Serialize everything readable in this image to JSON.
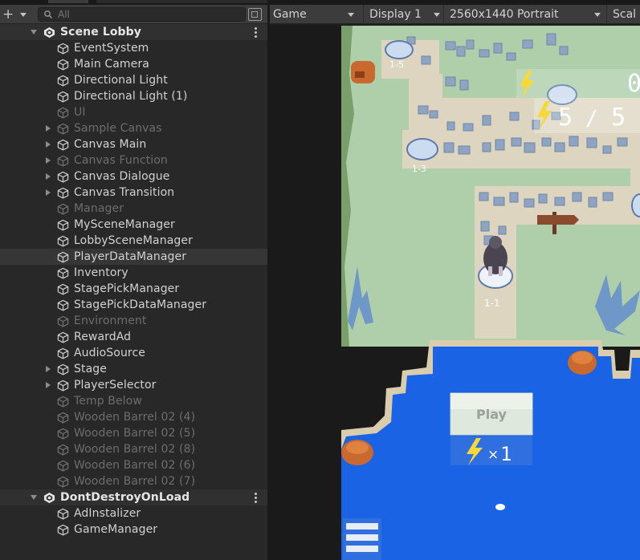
{
  "hierarchy": {
    "add_button": "+",
    "search": {
      "placeholder": "All",
      "value": ""
    },
    "items": [
      {
        "label": "Scene Lobby",
        "kind": "scene"
      },
      {
        "label": "EventSystem"
      },
      {
        "label": "Main Camera"
      },
      {
        "label": "Directional Light"
      },
      {
        "label": "Directional Light (1)"
      },
      {
        "label": "UI",
        "inactive": true
      },
      {
        "label": "Sample Canvas",
        "inactive": true,
        "collapsed": true
      },
      {
        "label": "Canvas Main",
        "collapsed": true
      },
      {
        "label": "Canvas Function",
        "inactive": true,
        "collapsed": true
      },
      {
        "label": "Canvas Dialogue",
        "collapsed": true
      },
      {
        "label": "Canvas Transition",
        "collapsed": true
      },
      {
        "label": "Manager",
        "inactive": true
      },
      {
        "label": "MySceneManager"
      },
      {
        "label": "LobbySceneManager"
      },
      {
        "label": "PlayerDataManager",
        "selected": true
      },
      {
        "label": "Inventory"
      },
      {
        "label": "StagePickManager"
      },
      {
        "label": "StagePickDataManager"
      },
      {
        "label": "Environment",
        "inactive": true
      },
      {
        "label": "RewardAd"
      },
      {
        "label": "AudioSource"
      },
      {
        "label": "Stage",
        "collapsed": true
      },
      {
        "label": "PlayerSelector",
        "collapsed": true
      },
      {
        "label": "Temp Below",
        "inactive": true
      },
      {
        "label": "Wooden Barrel 02 (4)",
        "inactive": true
      },
      {
        "label": "Wooden Barrel 02 (5)",
        "inactive": true
      },
      {
        "label": "Wooden Barrel 02 (8)",
        "inactive": true
      },
      {
        "label": "Wooden Barrel 02 (6)",
        "inactive": true
      },
      {
        "label": "Wooden Barrel 02 (7)",
        "inactive": true
      },
      {
        "label": "DontDestroyOnLoad",
        "kind": "scene"
      },
      {
        "label": "AdInstalizer"
      },
      {
        "label": "GameManager"
      }
    ]
  },
  "game_view": {
    "view_select": "Game",
    "display_select": "Display 1",
    "resolution_select": "2560x1440 Portrait",
    "scale_label": "Scal",
    "hud": {
      "energy_current": "5",
      "energy_separator": "/",
      "energy_max": "5",
      "top_right_partial": "0",
      "play_button": "Play",
      "cost_prefix": "×",
      "cost_value": "1"
    },
    "stages": [
      {
        "label": "1-5"
      },
      {
        "label": "1-3"
      },
      {
        "label": "1-1"
      }
    ]
  },
  "colors": {
    "panel": "#282828",
    "toolbar": "#3c3c3c",
    "text": "#d2d2d2",
    "text_inactive": "#6d6d6d",
    "selected_row": "#363636",
    "grass": "#aecfaa",
    "path": "#ddd5c0",
    "water": "#1a63e4",
    "rock": "#8fa4c0",
    "energy": "#f5d93a"
  }
}
